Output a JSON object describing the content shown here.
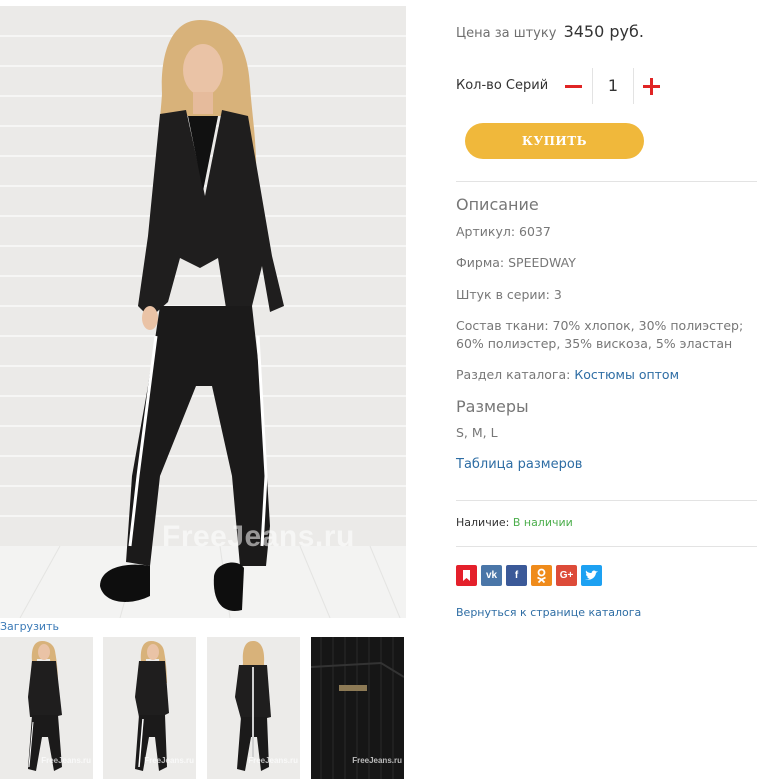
{
  "gallery": {
    "watermark": "FreeJeans.ru",
    "download_label": "Загрузить",
    "thumb_watermark": "FreeJeans.ru"
  },
  "product": {
    "price_label": "Цена за штуку",
    "price_value": "3450 руб.",
    "qty_label": "Кол-во Серий",
    "qty_value": "1",
    "buy_label": "КУПИТЬ"
  },
  "description": {
    "title": "Описание",
    "article": "Артикул: 6037",
    "brand": "Фирма: SPEEDWAY",
    "pieces": "Штук в серии: 3",
    "composition": "Состав ткани: 70% хлопок, 30% полиэстер; 60% полиэстер, 35% вискоза, 5% эластан",
    "catalog_label": "Раздел каталога:",
    "catalog_link": "Костюмы оптом"
  },
  "sizes": {
    "title": "Размеры",
    "values": "S, M, L",
    "table_link": "Таблица размеров"
  },
  "stock": {
    "label": "Наличие:",
    "value": "В наличии"
  },
  "share": {
    "buttons": [
      "bookmark-icon",
      "vk-icon",
      "facebook-icon",
      "odnoklassniki-icon",
      "google-plus-icon",
      "twitter-icon"
    ],
    "colors": {
      "bookmark": "#e4202b",
      "vk": "#4a76a8",
      "facebook": "#3b5998",
      "ok": "#ef8b1b",
      "gplus": "#dd4b39",
      "twitter": "#1da1f2"
    }
  },
  "back_link": "Вернуться к странице каталога",
  "colors": {
    "accent_button": "#f0b83b",
    "qty_controls": "#e02424",
    "link": "#2e6da4",
    "in_stock": "#4cae4c"
  }
}
